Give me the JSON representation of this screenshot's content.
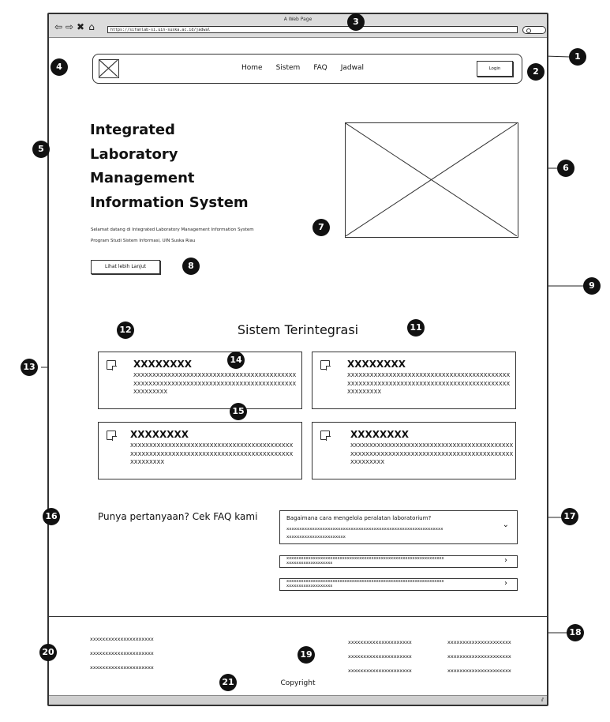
{
  "window": {
    "title": "A Web Page",
    "url": "https://sifanlab-si.uin-suska.ac.id/jadwal"
  },
  "header": {
    "menu": [
      "Home",
      "Sistem",
      "FAQ",
      "Jadwal"
    ],
    "login": "Login"
  },
  "hero": {
    "title_lines": [
      "Integrated",
      "Laboratory",
      "Management",
      "Information System"
    ],
    "desc_1": "Selamat datang di Integrated Laboratory Management Information System",
    "desc_2": "Program Studi Sistem Informasi, UIN Suska Riau",
    "button": "Lihat lebih Lanjut"
  },
  "section": {
    "title": "Sistem Terintegrasi"
  },
  "cards": [
    {
      "title": "XXXXXXXX",
      "body": "XXXXXXXXXXXXXXXXXXXXXXXXXXXXXXXXXXXXXXXXXXXXXXXXXXXXXXXXXXXXXXXXXXXXXXXXXXXXXXXXXXXXXXXXXXXXXXX"
    },
    {
      "title": "XXXXXXXX",
      "body": "XXXXXXXXXXXXXXXXXXXXXXXXXXXXXXXXXXXXXXXXXXXXXXXXXXXXXXXXXXXXXXXXXXXXXXXXXXXXXXXXXXXXXXXXXXXXXXX"
    },
    {
      "title": "XXXXXXXX",
      "body": "XXXXXXXXXXXXXXXXXXXXXXXXXXXXXXXXXXXXXXXXXXXXXXXXXXXXXXXXXXXXXXXXXXXXXXXXXXXXXXXXXXXXXXXXXXXXXXX"
    },
    {
      "title": "XXXXXXXX",
      "body": "XXXXXXXXXXXXXXXXXXXXXXXXXXXXXXXXXXXXXXXXXXXXXXXXXXXXXXXXXXXXXXXXXXXXXXXXXXXXXXXXXXXXXXXXXXXXXXX"
    }
  ],
  "faq": {
    "title": "Punya pertanyaan? Cek FAQ kami",
    "open_question": "Bagaimana cara mengelola peralatan laboratorium?",
    "open_answer": "xxxxxxxxxxxxxxxxxxxxxxxxxxxxxxxxxxxxxxxxxxxxxxxxxxxxxxxxxxxxxxxxxxxxxxxxxxxxxxxxxxxx",
    "row_1": "xxxxxxxxxxxxxxxxxxxxxxxxxxxxxxxxxxxxxxxxxxxxxxxxxxxxxxxxxxxxxxxxxxxxxxxxxxxxxxxxxxxx",
    "row_2": "xxxxxxxxxxxxxxxxxxxxxxxxxxxxxxxxxxxxxxxxxxxxxxxxxxxxxxxxxxxxxxxxxxxxxxxxxxxxxxxxxxxx",
    "chevron_open": "⌄",
    "chevron_closed": "›"
  },
  "footer": {
    "left": [
      "xxxxxxxxxxxxxxxxxxxxx",
      "xxxxxxxxxxxxxxxxxxxxx",
      "xxxxxxxxxxxxxxxxxxxxx"
    ],
    "mid": [
      "xxxxxxxxxxxxxxxxxxxxx",
      "xxxxxxxxxxxxxxxxxxxxx",
      "xxxxxxxxxxxxxxxxxxxxx"
    ],
    "right": [
      "xxxxxxxxxxxxxxxxxxxxx",
      "xxxxxxxxxxxxxxxxxxxxx",
      "xxxxxxxxxxxxxxxxxxxxx"
    ],
    "copyright": "Copyright"
  },
  "markers": [
    "1",
    "2",
    "3",
    "4",
    "5",
    "6",
    "7",
    "8",
    "9",
    "11",
    "12",
    "13",
    "14",
    "15",
    "16",
    "17",
    "18",
    "19",
    "20",
    "21"
  ]
}
